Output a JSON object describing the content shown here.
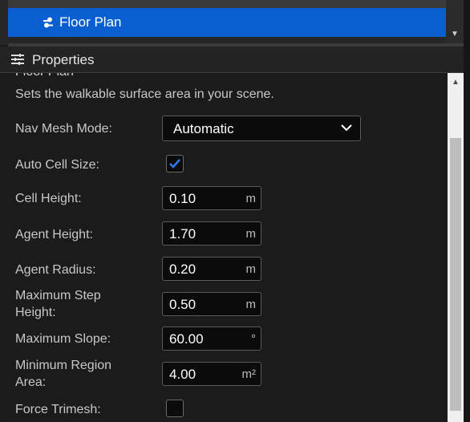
{
  "outliner": {
    "selected_item": "Floor Plan",
    "selected_icon": "floor-plan-icon"
  },
  "properties": {
    "header": "Properties",
    "header_icon": "sliders-icon",
    "section_title": "Floor Plan",
    "description": "Sets the walkable surface area in your scene.",
    "fields": {
      "nav_mesh_mode": {
        "label": "Nav Mesh Mode:",
        "value": "Automatic"
      },
      "auto_cell_size": {
        "label": "Auto Cell Size:",
        "checked": true
      },
      "cell_height": {
        "label": "Cell Height:",
        "value": "0.10",
        "unit": "m"
      },
      "agent_height": {
        "label": "Agent Height:",
        "value": "1.70",
        "unit": "m"
      },
      "agent_radius": {
        "label": "Agent Radius:",
        "value": "0.20",
        "unit": "m"
      },
      "max_step_height": {
        "label_line1": "Maximum Step",
        "label_line2": "Height:",
        "value": "0.50",
        "unit": "m"
      },
      "max_slope": {
        "label": "Maximum Slope:",
        "value": "60.00",
        "unit": "°"
      },
      "min_region_area": {
        "label_line1": "Minimum Region",
        "label_line2": "Area:",
        "value": "4.00",
        "unit": "m²"
      },
      "force_trimesh": {
        "label": "Force Trimesh:",
        "checked": false
      }
    }
  },
  "colors": {
    "accent": "#0a5fd0",
    "checkmark": "#2b7bf0",
    "background": "#1b1b1b"
  }
}
